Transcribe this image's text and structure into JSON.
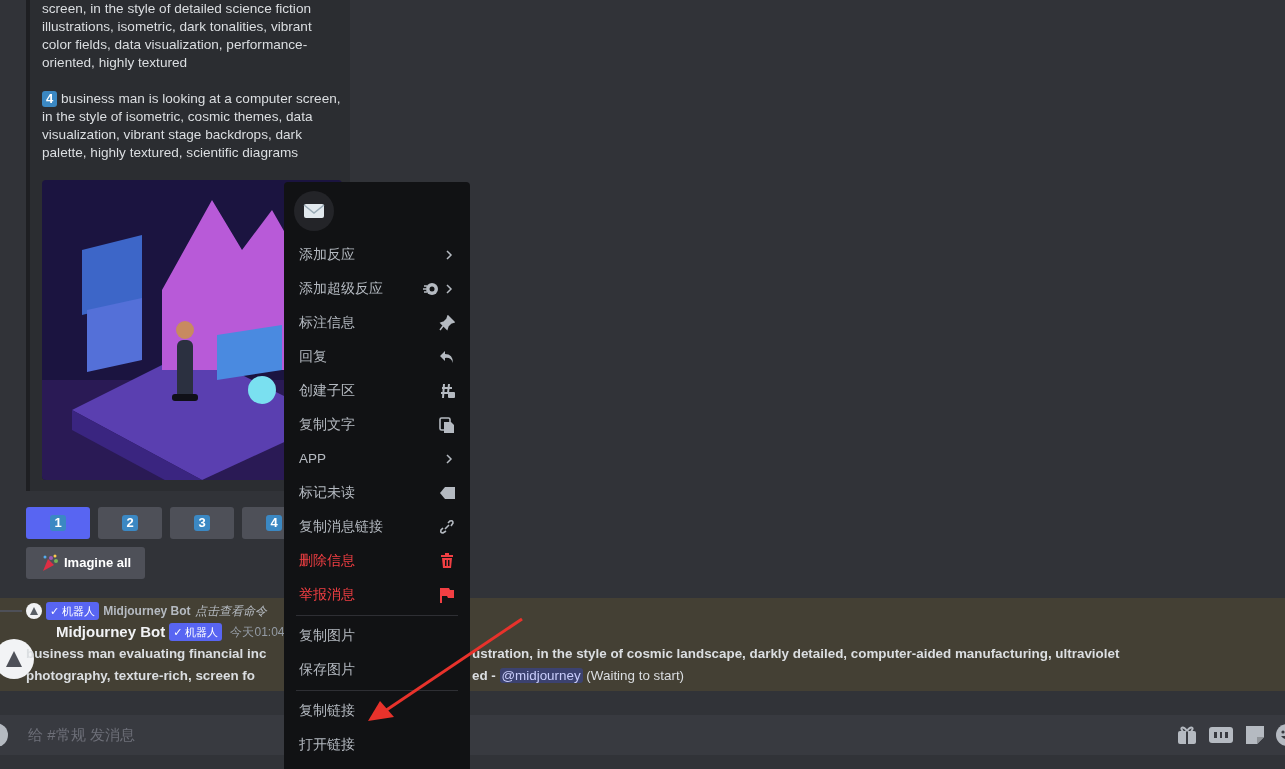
{
  "embed": {
    "prompts": [
      {
        "text": "screen, in the style of detailed science fiction illustrations, isometric, dark tonalities, vibrant color fields, data visualization, performance-oriented, highly textured"
      },
      {
        "number": "4",
        "text": "business man is looking at a computer screen, in the style of isometric, cosmic themes, data visualization, vibrant stage backdrops, dark palette, highly textured, scientific diagrams"
      }
    ]
  },
  "variant_buttons": [
    {
      "label": "1",
      "selected": true
    },
    {
      "label": "2",
      "selected": false
    },
    {
      "label": "3",
      "selected": false
    },
    {
      "label": "4",
      "selected": false
    }
  ],
  "imagine_all": {
    "label": "Imagine all"
  },
  "message": {
    "highlighted": true,
    "reply": {
      "badge": "✓ 机器人",
      "author": "Midjourney Bot",
      "hint": "点击查看命令"
    },
    "author": "Midjourney Bot",
    "badge": "✓ 机器人",
    "time": "今天01:04",
    "lines": [
      {
        "left": "business man evaluating financial inc",
        "right": "ustration, in the style of cosmic landscape, darkly detailed, computer-aided manufacturing, ultraviolet"
      },
      {
        "left": "photography, texture-rich, screen fo",
        "right": "ed - ",
        "mention": "@midjourney",
        "status": "(Waiting to start)"
      }
    ]
  },
  "composer": {
    "placeholder": "给 #常规 发消息"
  },
  "context_menu": {
    "sections": [
      [
        {
          "label": "添加反应",
          "kind": "submenu",
          "danger": false
        },
        {
          "label": "添加超级反应",
          "kind": "super",
          "danger": false
        },
        {
          "label": "标注信息",
          "kind": "pin",
          "danger": false
        },
        {
          "label": "回复",
          "kind": "reply",
          "danger": false
        },
        {
          "label": "创建子区",
          "kind": "thread",
          "danger": false
        },
        {
          "label": "复制文字",
          "kind": "copy",
          "danger": false
        },
        {
          "label": "APP",
          "kind": "submenu",
          "danger": false
        },
        {
          "label": "标记未读",
          "kind": "unread",
          "danger": false
        },
        {
          "label": "复制消息链接",
          "kind": "link",
          "danger": false
        },
        {
          "label": "删除信息",
          "kind": "delete",
          "danger": true
        },
        {
          "label": "举报消息",
          "kind": "report",
          "danger": true
        }
      ],
      [
        {
          "label": "复制图片",
          "kind": "plain",
          "danger": false
        },
        {
          "label": "保存图片",
          "kind": "plain",
          "danger": false
        }
      ],
      [
        {
          "label": "复制链接",
          "kind": "plain",
          "danger": false
        },
        {
          "label": "打开链接",
          "kind": "plain",
          "danger": false
        }
      ]
    ]
  }
}
